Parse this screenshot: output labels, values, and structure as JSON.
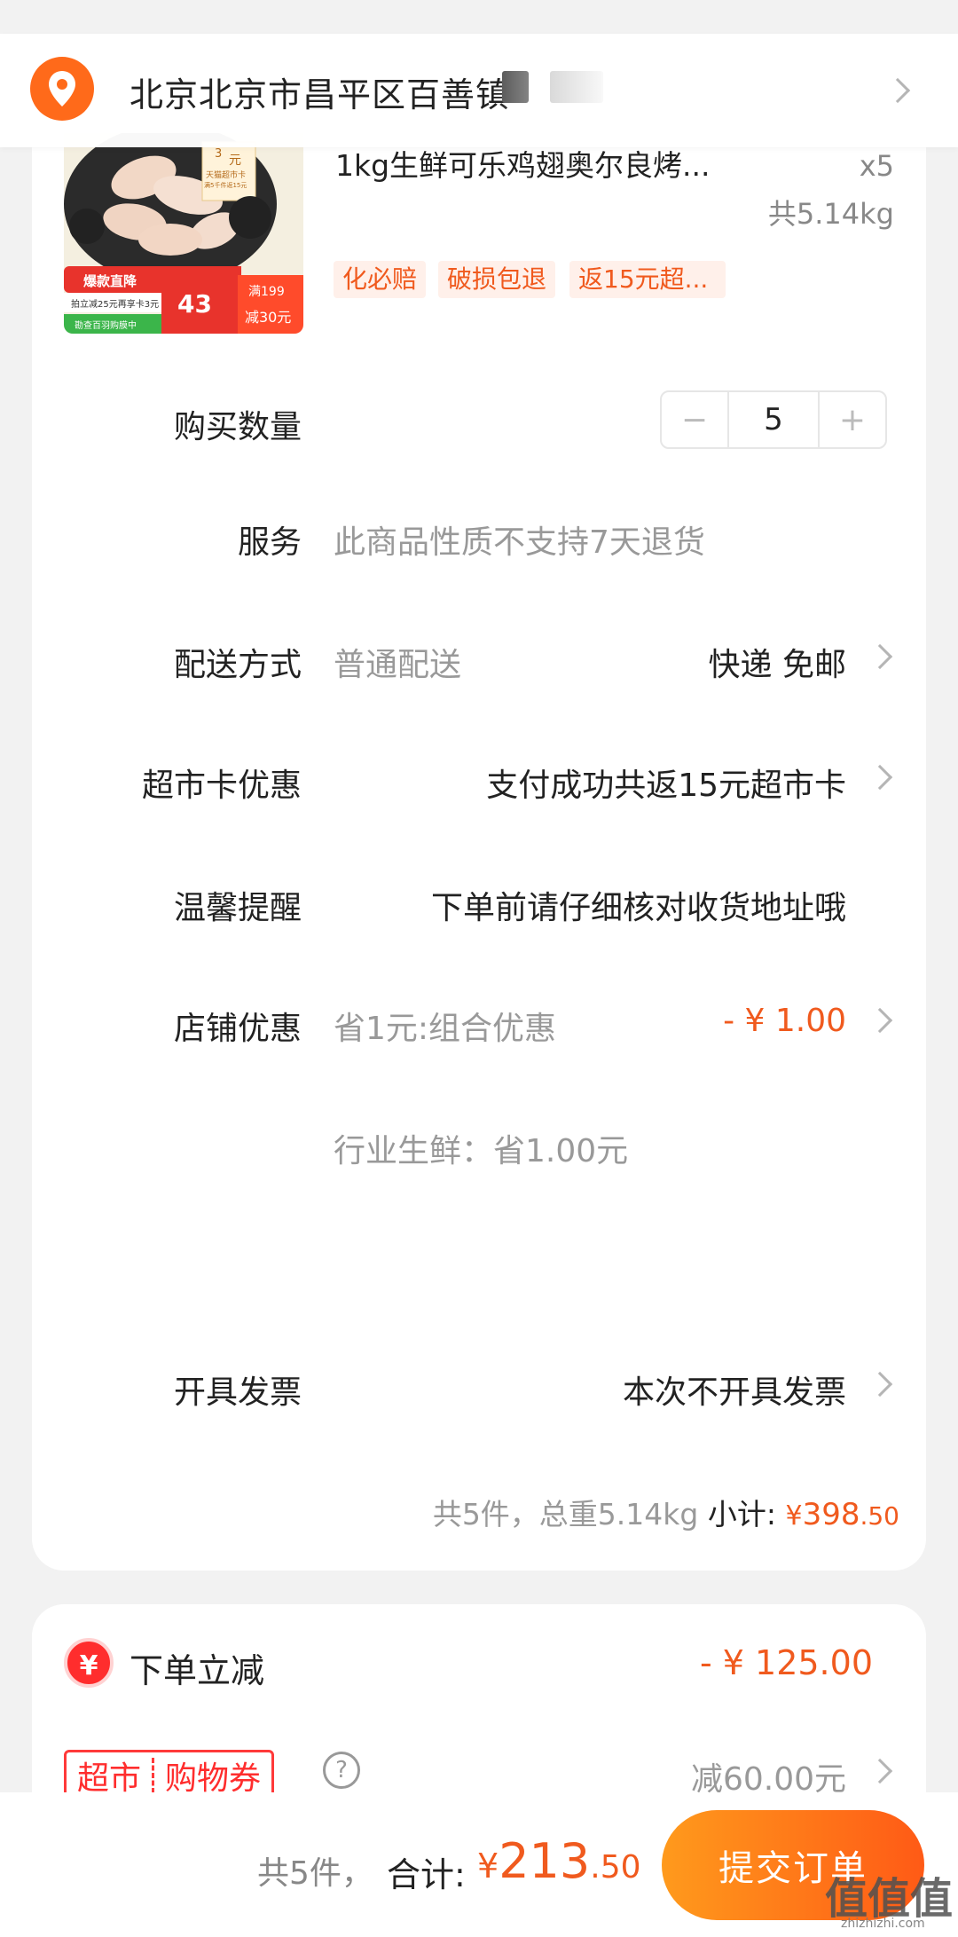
{
  "address": {
    "text": "北京北京市昌平区百善镇"
  },
  "product": {
    "title": "1kg生鲜可乐鸡翅奥尔良烤...",
    "quantity": "x5",
    "weight": "共5.14kg",
    "tags": [
      "化必赔",
      "破损包退",
      "返15元超..."
    ],
    "image_texts": {
      "badge_price": "3",
      "badge_unit": "元",
      "badge_line1": "天猫超市卡",
      "badge_line2": "满5千件返15元",
      "promo": "爆款直降",
      "promo2": "拍立减25元再享卡3元",
      "promo3": "勘查百羽购膜中",
      "big_price": "43",
      "full_reduce1": "满199",
      "full_reduce2": "减30元"
    }
  },
  "rows": {
    "purchase_qty_label": "购买数量",
    "qty_value": "5",
    "minus": "−",
    "plus": "+",
    "service_label": "服务",
    "service_value": "此商品性质不支持7天退货",
    "delivery_label": "配送方式",
    "delivery_type": "普通配送",
    "delivery_value": "快递 免邮",
    "card_label": "超市卡优惠",
    "card_value": "支付成功共返15元超市卡",
    "reminder_label": "温馨提醒",
    "reminder_value": "下单前请仔细核对收货地址哦",
    "store_label": "店铺优惠",
    "store_desc": "省1元:组合优惠",
    "store_value": "- ¥ 1.00",
    "industry_desc": "行业生鲜：省1.00元",
    "invoice_label": "开具发票",
    "invoice_value": "本次不开具发票"
  },
  "subtotal": {
    "summary": "共5件，总重5.14kg",
    "label": "小计:",
    "currency": "¥",
    "int": "398",
    "dec": ".50"
  },
  "discounts": {
    "instant_icon": "¥",
    "instant_label": "下单立减",
    "instant_value": "- ¥ 125.00",
    "coupon_left": "超市",
    "coupon_right": "购物券",
    "help": "?",
    "coupon_value": "减60.00元"
  },
  "footer": {
    "count": "共5件，",
    "total_label": "合计:",
    "currency": "¥",
    "total_int": "213",
    "total_dec": ".50",
    "submit": "提交订单"
  },
  "watermark": {
    "text": "值值值",
    "site": "zhizhizhi.com"
  },
  "colors": {
    "accent": "#f05a1e",
    "pin": "#ff6a1a",
    "coupon_red": "#ff2d2d",
    "button_start": "#ff9a1c",
    "button_end": "#ff5a16"
  }
}
